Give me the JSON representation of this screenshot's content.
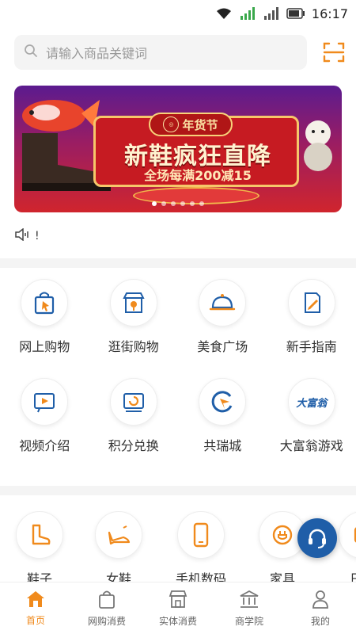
{
  "status_bar": {
    "time": "16:17"
  },
  "search": {
    "placeholder": "请输入商品关键词"
  },
  "banner": {
    "badge": "年货节",
    "title": "新鞋疯狂直降",
    "subtitle": "全场每满200减15"
  },
  "notice": {
    "text": "!"
  },
  "features": [
    {
      "label": "网上购物",
      "icon": "shopping-bag-icon"
    },
    {
      "label": "逛街购物",
      "icon": "storefront-icon"
    },
    {
      "label": "美食广场",
      "icon": "food-dome-icon"
    },
    {
      "label": "新手指南",
      "icon": "guide-icon"
    },
    {
      "label": "视频介绍",
      "icon": "video-icon"
    },
    {
      "label": "积分兑换",
      "icon": "points-exchange-icon"
    },
    {
      "label": "共瑞城",
      "icon": "gongrui-logo-icon"
    },
    {
      "label": "大富翁游戏",
      "icon": "monopoly-icon"
    }
  ],
  "categories": [
    {
      "label": "鞋子",
      "icon": "boot-icon"
    },
    {
      "label": "女鞋",
      "icon": "high-heel-icon"
    },
    {
      "label": "手机数码",
      "icon": "phone-icon"
    },
    {
      "label": "家具",
      "icon": "plug-icon"
    },
    {
      "label": "日用",
      "icon": "daily-icon"
    }
  ],
  "monopoly_logo_text": "大富翁",
  "bottom_nav": [
    {
      "label": "首页",
      "icon": "home-icon",
      "active": true
    },
    {
      "label": "网购消费",
      "icon": "bag-icon",
      "active": false
    },
    {
      "label": "实体消费",
      "icon": "store-icon",
      "active": false
    },
    {
      "label": "商学院",
      "icon": "bank-icon",
      "active": false
    },
    {
      "label": "我的",
      "icon": "user-icon",
      "active": false
    }
  ],
  "colors": {
    "accent": "#f08a1c",
    "icon_blue": "#1f5ea8",
    "banner_red": "#c61b22"
  }
}
